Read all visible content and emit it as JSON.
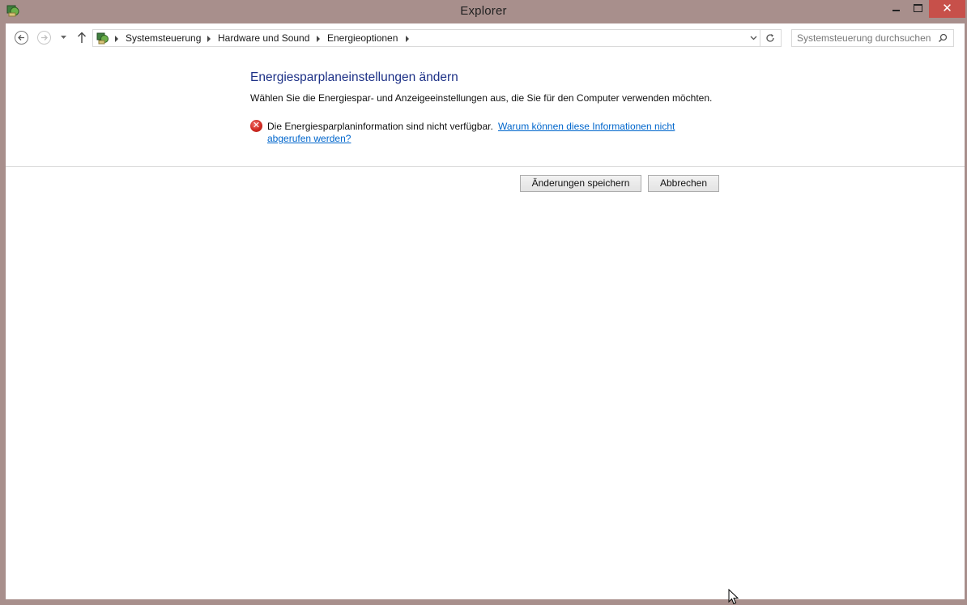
{
  "window": {
    "title": "Explorer",
    "minimize_glyph": "",
    "close_glyph": "✕"
  },
  "navigation": {
    "breadcrumbs": [
      {
        "label": "Systemsteuerung"
      },
      {
        "label": "Hardware und Sound"
      },
      {
        "label": "Energieoptionen"
      }
    ],
    "search_placeholder": "Systemsteuerung durchsuchen"
  },
  "content": {
    "title": "Energiesparplaneinstellungen ändern",
    "description": "Wählen Sie die Energiespar- und Anzeigeeinstellungen aus, die Sie für den Computer verwenden möchten.",
    "error": {
      "message": "Die Energiesparplaninformation sind nicht verfügbar.",
      "link": "Warum können diese Informationen nicht abgerufen werden?",
      "icon": "error-icon"
    },
    "buttons": {
      "save": "Änderungen speichern",
      "cancel": "Abbrechen"
    }
  },
  "colors": {
    "titlebar": "#a88f8c",
    "close_button": "#c7504a",
    "title_text": "#1e3287",
    "link": "#0066cc",
    "error": "#d02a22"
  }
}
